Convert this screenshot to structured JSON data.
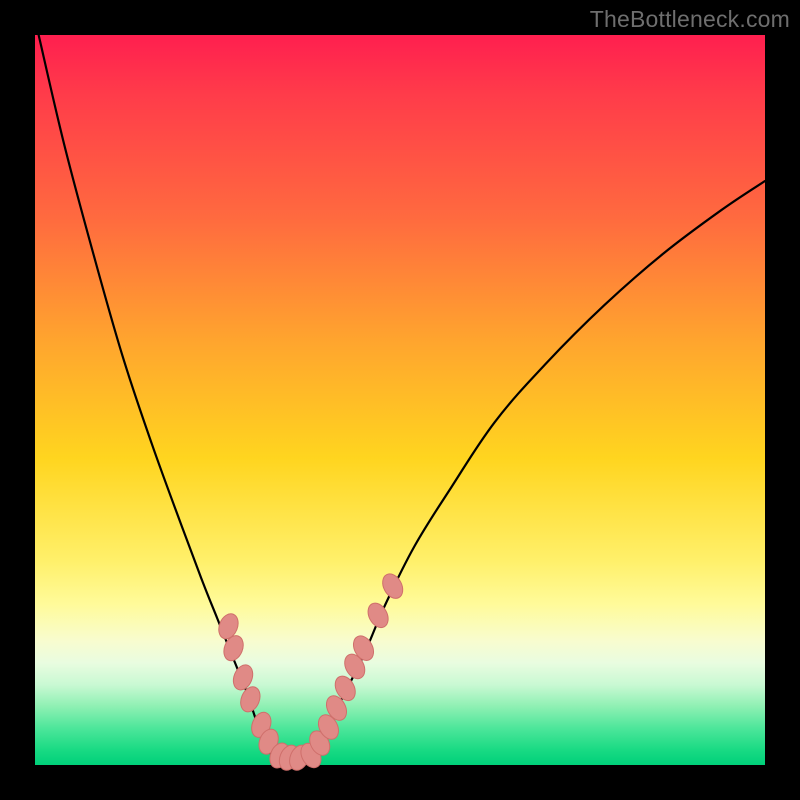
{
  "watermark": "TheBottleneck.com",
  "chart_data": {
    "type": "line",
    "title": "",
    "xlabel": "",
    "ylabel": "",
    "xlim": [
      0,
      100
    ],
    "ylim": [
      0,
      100
    ],
    "grid": false,
    "legend": false,
    "series": [
      {
        "name": "left-curve",
        "x": [
          0.5,
          4,
          8,
          12,
          16,
          20,
          23,
          25,
          27,
          29,
          30,
          31,
          32,
          33
        ],
        "y": [
          100,
          85,
          70,
          56,
          44,
          33,
          25,
          20,
          15,
          10,
          7,
          4,
          2,
          0.8
        ]
      },
      {
        "name": "right-curve",
        "x": [
          37,
          38,
          40,
          42,
          45,
          48,
          52,
          57,
          63,
          70,
          78,
          86,
          94,
          100
        ],
        "y": [
          0.8,
          2,
          5,
          9,
          15,
          22,
          30,
          38,
          47,
          55,
          63,
          70,
          76,
          80
        ]
      }
    ],
    "flat_bottom": {
      "x_start": 33,
      "x_end": 37,
      "y": 0.8
    },
    "markers_left": [
      {
        "x": 26.5,
        "y": 19
      },
      {
        "x": 27.2,
        "y": 16
      },
      {
        "x": 28.5,
        "y": 12
      },
      {
        "x": 29.5,
        "y": 9
      },
      {
        "x": 31,
        "y": 5.5
      },
      {
        "x": 32,
        "y": 3.2
      },
      {
        "x": 33.5,
        "y": 1.3
      },
      {
        "x": 34.8,
        "y": 1.0
      },
      {
        "x": 36.2,
        "y": 1.0
      }
    ],
    "markers_right": [
      {
        "x": 37.8,
        "y": 1.3
      },
      {
        "x": 39,
        "y": 3
      },
      {
        "x": 40.2,
        "y": 5.2
      },
      {
        "x": 41.3,
        "y": 7.8
      },
      {
        "x": 42.5,
        "y": 10.5
      },
      {
        "x": 43.8,
        "y": 13.5
      },
      {
        "x": 45,
        "y": 16
      },
      {
        "x": 47,
        "y": 20.5
      },
      {
        "x": 49,
        "y": 24.5
      }
    ],
    "colors": {
      "curve": "#000000",
      "marker_fill": "#e08a86",
      "marker_stroke": "#cf6f6b"
    }
  }
}
